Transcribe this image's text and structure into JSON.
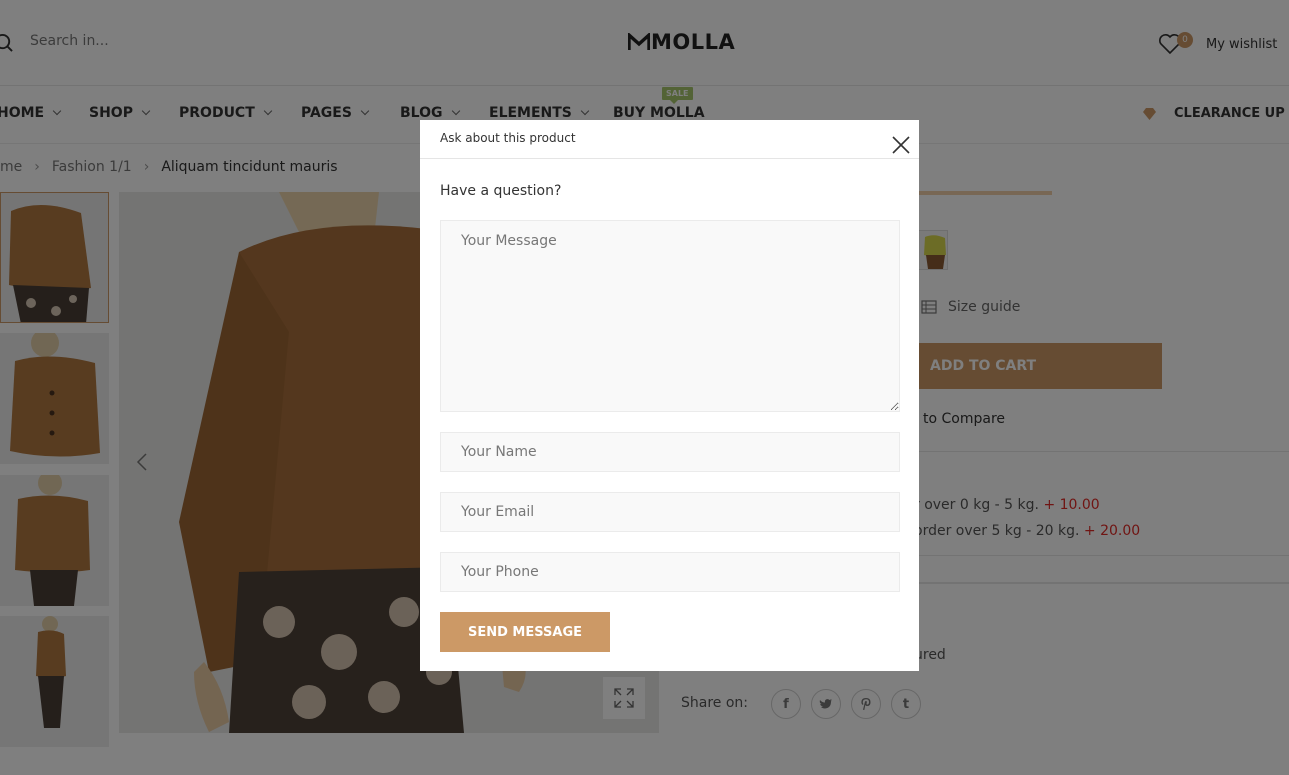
{
  "header": {
    "search_placeholder": "Search in...",
    "logo_text": "MOLLA",
    "wishlist_count": "0",
    "wishlist_label": "My wishlist"
  },
  "nav": {
    "items": [
      {
        "label": "HOME"
      },
      {
        "label": "SHOP"
      },
      {
        "label": "PRODUCT"
      },
      {
        "label": "PAGES"
      },
      {
        "label": "BLOG"
      },
      {
        "label": "ELEMENTS"
      },
      {
        "label": "BUY MOLLA"
      }
    ],
    "sale_badge": "SALE",
    "clearance": "CLEARANCE UP T"
  },
  "breadcrumb": {
    "items": [
      "me",
      "Fashion 1/1",
      "Aliquam tincidunt mauris"
    ]
  },
  "product_panel": {
    "progress_fraction": 1.0,
    "size_guide": "Size guide",
    "add_to_cart": "ADD TO CART",
    "compare": "to Compare",
    "shipping": [
      {
        "text": "r over 0 kg - 5 kg.",
        "price": "+ 10.00"
      },
      {
        "text": "order over 5 kg - 20 kg.",
        "price": "+ 20.00"
      }
    ],
    "featured": "ured",
    "share_label": "Share on:"
  },
  "modal": {
    "title": "Ask about this product",
    "question": "Have a question?",
    "message_placeholder": "Your Message",
    "name_placeholder": "Your Name",
    "email_placeholder": "Your Email",
    "phone_placeholder": "Your Phone",
    "send_label": "SEND MESSAGE"
  },
  "colors": {
    "accent": "#cc9966",
    "sale_green": "#a6c76c",
    "price_red": "#e02b27"
  },
  "icons": [
    "search-icon",
    "heart-icon",
    "diamond-icon",
    "chevron-left-icon",
    "expand-icon",
    "table-icon",
    "close-icon",
    "facebook-icon",
    "twitter-icon",
    "pinterest-icon",
    "tumblr-icon"
  ]
}
